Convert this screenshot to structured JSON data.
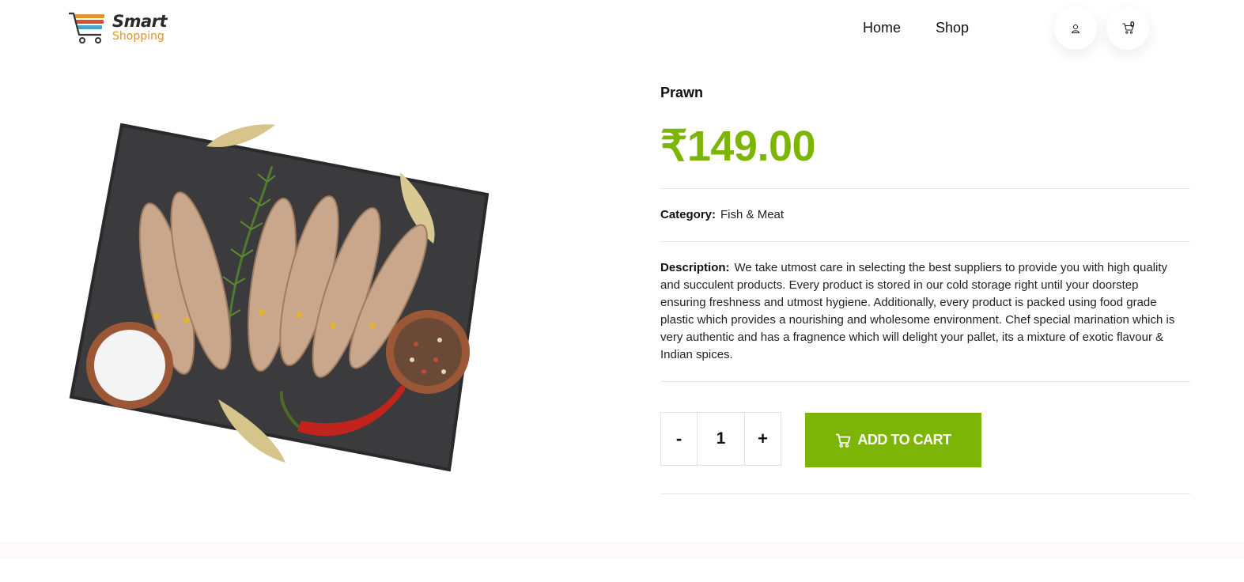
{
  "header": {
    "logo": {
      "top": "Smart",
      "bottom": "Shopping"
    },
    "nav": [
      "Home",
      "Shop"
    ],
    "cart_count": "0",
    "icons": {
      "user": "user-icon",
      "cart": "cart-icon"
    }
  },
  "product": {
    "name": "Prawn",
    "price": "₹149.00",
    "category_label": "Category:",
    "category_value": "Fish & Meat",
    "description_label": "Description:",
    "description": "We take utmost care in selecting the best suppliers to provide you with high quality and succulent products. Every product is stored in our cold storage right until your doorstep ensuring freshness and utmost hygiene. Additionally, every product is packed using food grade plastic which provides a nourishing and wholesome environment. Chef special marination which is very authentic and has a fragnence which will delight your pallet, its a mixture of exotic flavour & Indian spices.",
    "quantity": "1",
    "minus_label": "-",
    "plus_label": "+",
    "add_to_cart_label": "ADD TO CART"
  },
  "colors": {
    "accent": "#7db507",
    "logo_orange": "#e0962c"
  }
}
